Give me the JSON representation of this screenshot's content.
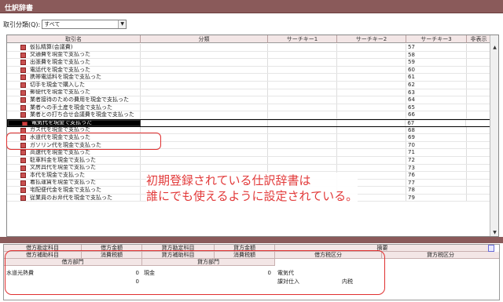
{
  "window": {
    "title": "仕訳辞書"
  },
  "filter": {
    "label": "取引分類(Q):",
    "value": "すべて"
  },
  "columns": [
    "取引名",
    "分類",
    "サーチキー1",
    "サーチキー2",
    "サーチキー3",
    "非表示"
  ],
  "rows": [
    {
      "name": "仮払精算(会議費)",
      "key3": "57"
    },
    {
      "name": "交通費を現金で支払った",
      "key3": "58"
    },
    {
      "name": "出張費を現金で支払った",
      "key3": "59"
    },
    {
      "name": "電話代を現金で支払った",
      "key3": "60"
    },
    {
      "name": "携帯電話料を現金で支払った",
      "key3": "61"
    },
    {
      "name": "切手を現金で購入した",
      "key3": "62"
    },
    {
      "name": "郵便代を現金で支払った",
      "key3": "63"
    },
    {
      "name": "業者接待のための費用を現金で支払った",
      "key3": "64"
    },
    {
      "name": "業者への手土産を現金で支払った",
      "key3": "65"
    },
    {
      "name": "業者との打ち合せ会議費を現金で支払った",
      "key3": "66"
    },
    {
      "name": "電気代を現金で支払った",
      "key3": "67"
    },
    {
      "name": "ガス代を現金で支払った",
      "key3": "68"
    },
    {
      "name": "水道代を現金で支払った",
      "key3": "69"
    },
    {
      "name": "ガソリン代を現金で支払った",
      "key3": "70"
    },
    {
      "name": "高速代を現金で支払った",
      "key3": "71"
    },
    {
      "name": "駐車料金を現金で支払った",
      "key3": "72"
    },
    {
      "name": "文房具代を現金で支払った",
      "key3": "73"
    },
    {
      "name": "本代を現金で支払った",
      "key3": "76"
    },
    {
      "name": "着払運賃を現金で支払った",
      "key3": "77"
    },
    {
      "name": "宅配便代金を現金で支払った",
      "key3": "78"
    },
    {
      "name": "従業員のお弁代を現金で支払った",
      "key3": "79"
    }
  ],
  "selected_index": 10,
  "callout": {
    "line1": "初期登録されている仕訳辞書は",
    "line2": "誰にでも使えるように設定されている。"
  },
  "detail_headers": {
    "row1": [
      "借方勘定科目",
      "借方金額",
      "貸方勘定科目",
      "貸方金額",
      "摘要"
    ],
    "row2": [
      "借方補助科目",
      "消費税額",
      "貸方補助科目",
      "消費税額",
      "借方税区分",
      "貸方税区分"
    ],
    "row3": [
      "借方部門",
      "貸方部門"
    ]
  },
  "detail_values": {
    "debit_account": "水道光熱費",
    "debit_amount": "0",
    "credit_account": "現金",
    "credit_amount": "0",
    "memo": "電気代",
    "debit_tax_amount": "0",
    "debit_tax_type": "課対仕入",
    "debit_tax_sub": "内税"
  },
  "colors": {
    "accent": "#8a5a5a",
    "highlight": "#e03030"
  }
}
